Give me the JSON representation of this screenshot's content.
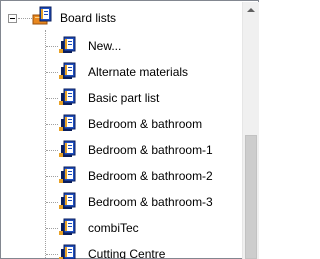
{
  "tree": {
    "root": {
      "label": "Board lists",
      "expanded": true,
      "icon": "book-icon"
    },
    "children": [
      {
        "label": "New...",
        "icon": "book-icon"
      },
      {
        "label": "Alternate materials",
        "icon": "book-icon"
      },
      {
        "label": "Basic part list",
        "icon": "book-icon"
      },
      {
        "label": "Bedroom & bathroom",
        "icon": "book-icon"
      },
      {
        "label": "Bedroom & bathroom-1",
        "icon": "book-icon"
      },
      {
        "label": "Bedroom & bathroom-2",
        "icon": "book-icon"
      },
      {
        "label": "Bedroom & bathroom-3",
        "icon": "book-icon"
      },
      {
        "label": "combiTec",
        "icon": "book-icon"
      },
      {
        "label": "Cutting Centre",
        "icon": "book-icon"
      }
    ]
  },
  "colors": {
    "book_blue": "#1f4fbf",
    "book_dark": "#0a1e5c",
    "book_gold": "#e8a227",
    "book_pages": "#ffffff",
    "root_icon_orange": "#e8871e"
  }
}
